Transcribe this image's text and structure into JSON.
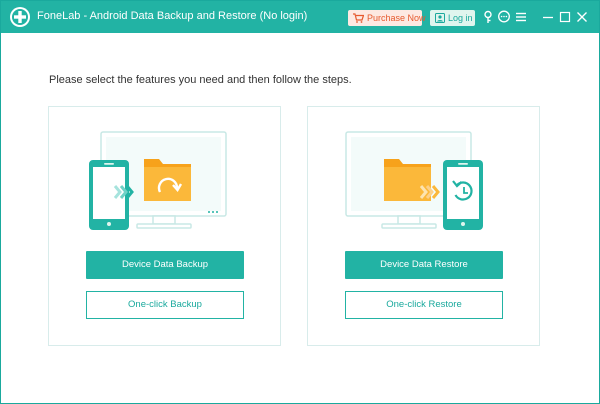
{
  "window": {
    "title": "FoneLab - Android Data Backup and Restore (No login)",
    "accent_color": "#22b3a4"
  },
  "titlebar": {
    "purchase_label": "Purchase Now",
    "login_label": "Log in",
    "icons": [
      "key-icon",
      "chat-icon",
      "menu-icon",
      "minimize-icon",
      "maximize-icon",
      "close-icon"
    ]
  },
  "main": {
    "instruction": "Please select the features you need and then follow the steps.",
    "backup": {
      "primary_label": "Device Data Backup",
      "secondary_label": "One-click Backup"
    },
    "restore": {
      "primary_label": "Device Data Restore",
      "secondary_label": "One-click Restore"
    }
  }
}
